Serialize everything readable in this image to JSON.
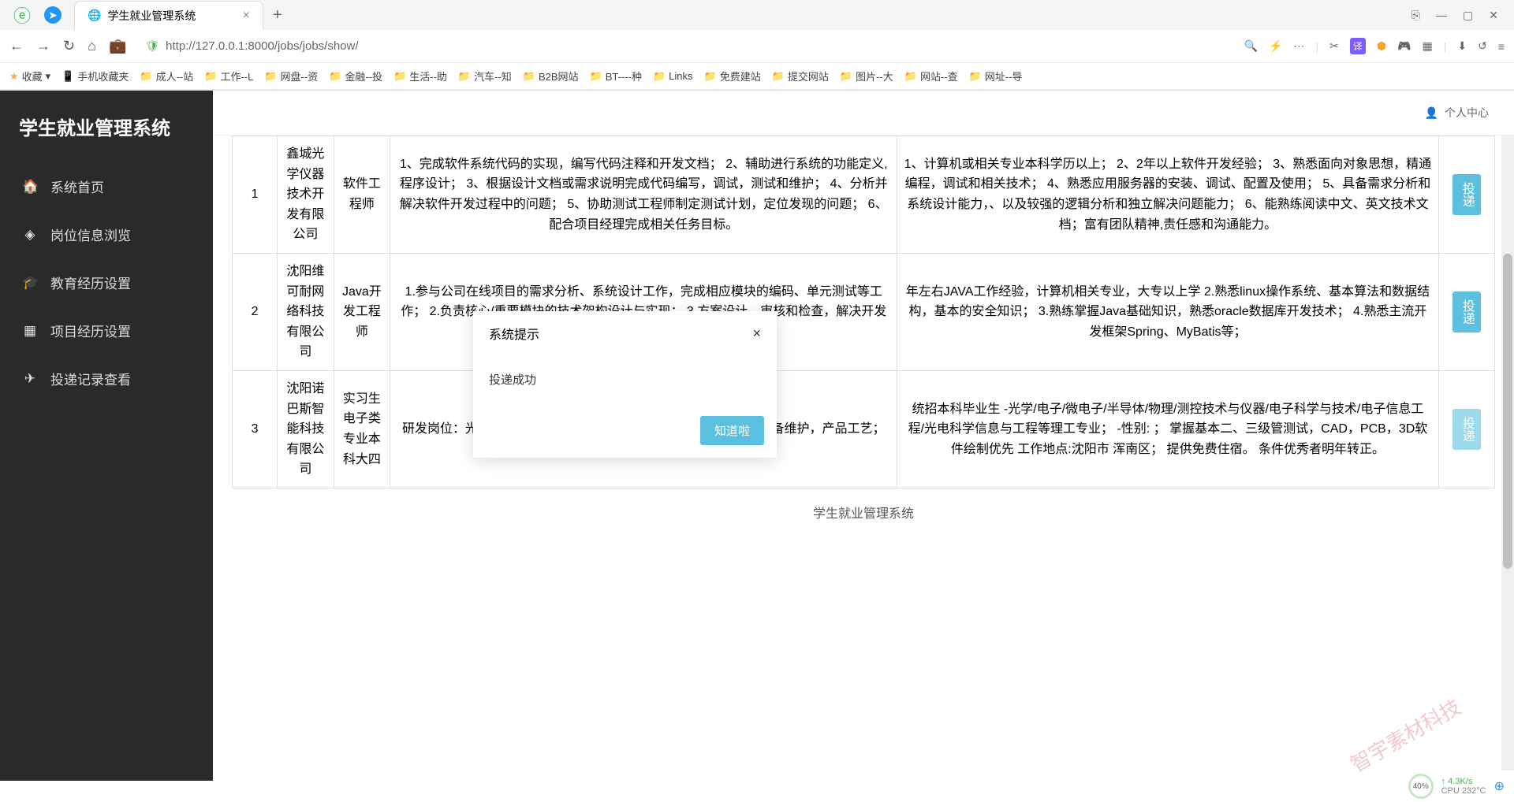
{
  "browser": {
    "tab_title": "学生就业管理系统",
    "url": "http://127.0.0.1:8000/jobs/jobs/show/",
    "window_controls": {
      "min": "—",
      "max": "▢",
      "close": "✕",
      "extra": "⎘"
    }
  },
  "bookmarks": {
    "fav": "收藏",
    "mobile": "手机收藏夹",
    "items": [
      "成人--站",
      "工作--L",
      "网盘--资",
      "金融--投",
      "生活--助",
      "汽车--知",
      "B2B网站",
      "BT----种",
      "Links",
      "免费建站",
      "提交网站",
      "图片--大",
      "网站--查",
      "网址--导"
    ]
  },
  "sidebar": {
    "title": "学生就业管理系统",
    "items": [
      {
        "icon": "🏠",
        "label": "系统首页"
      },
      {
        "icon": "◈",
        "label": "岗位信息浏览"
      },
      {
        "icon": "🎓",
        "label": "教育经历设置"
      },
      {
        "icon": "▦",
        "label": "项目经历设置"
      },
      {
        "icon": "✈",
        "label": "投递记录查看"
      }
    ]
  },
  "header": {
    "user_center": "个人中心"
  },
  "table": {
    "rows": [
      {
        "idx": "1",
        "company": "鑫城光学仪器技术开发有限公司",
        "position": "软件工程师",
        "desc": "1、完成软件系统代码的实现，编写代码注释和开发文档； 2、辅助进行系统的功能定义,程序设计； 3、根据设计文档或需求说明完成代码编写，调试，测试和维护； 4、分析并解决软件开发过程中的问题； 5、协助测试工程师制定测试计划，定位发现的问题； 6、配合项目经理完成相关任务目标。",
        "req": "1、计算机或相关专业本科学历以上； 2、2年以上软件开发经验； 3、熟悉面向对象思想，精通编程，调试和相关技术； 4、熟悉应用服务器的安装、调试、配置及使用； 5、具备需求分析和系统设计能力，、以及较强的逻辑分析和独立解决问题能力； 6、能熟练阅读中文、英文技术文档；富有团队精神,责任感和沟通能力。",
        "action": "投递"
      },
      {
        "idx": "2",
        "company": "沈阳维可耐网络科技有限公司",
        "position": "Java开发工程师",
        "desc": "1.参与公司在线项目的需求分析、系统设计工作，完成相应模块的编码、单元测试等工作； 2.负责核心/重要模块的技术架构设计与实现； 3.方案设计、审核和检查，解决开发过程中的技术难点问题；",
        "req": "年左右JAVA工作经验，计算机相关专业，大专以上学 2.熟悉linux操作系统、基本算法和数据结构，基本的安全知识； 3.熟练掌握Java基础知识，熟悉oracle数据库开发技术； 4.熟悉主流开发框架Spring、MyBatis等；",
        "action": "投递"
      },
      {
        "idx": "3",
        "company": "沈阳诺巴斯智能科技有限公司",
        "position": "实习生电子类专业本科大四",
        "desc": "研发岗位：光电传感器设计； 生产技术工程师岗位：生产及测试设备维护，产品工艺；",
        "req": "统招本科毕业生 -光学/电子/微电子/半导体/物理/测控技术与仪器/电子科学与技术/电子信息工程/光电科学信息与工程等理工专业； -性别:  ； 掌握基本二、三级管测试，CAD，PCB，3D软件绘制优先 工作地点:沈阳市 浑南区； 提供免费住宿。 条件优秀者明年转正。",
        "action": "投递"
      }
    ]
  },
  "modal": {
    "title": "系统提示",
    "message": "投递成功",
    "ok": "知道啦"
  },
  "footer": "学生就业管理系统",
  "watermark": "智宇素材科技",
  "status": {
    "percent": "40%",
    "speed": "4.3K/s",
    "cpu": "CPU 232°C"
  }
}
